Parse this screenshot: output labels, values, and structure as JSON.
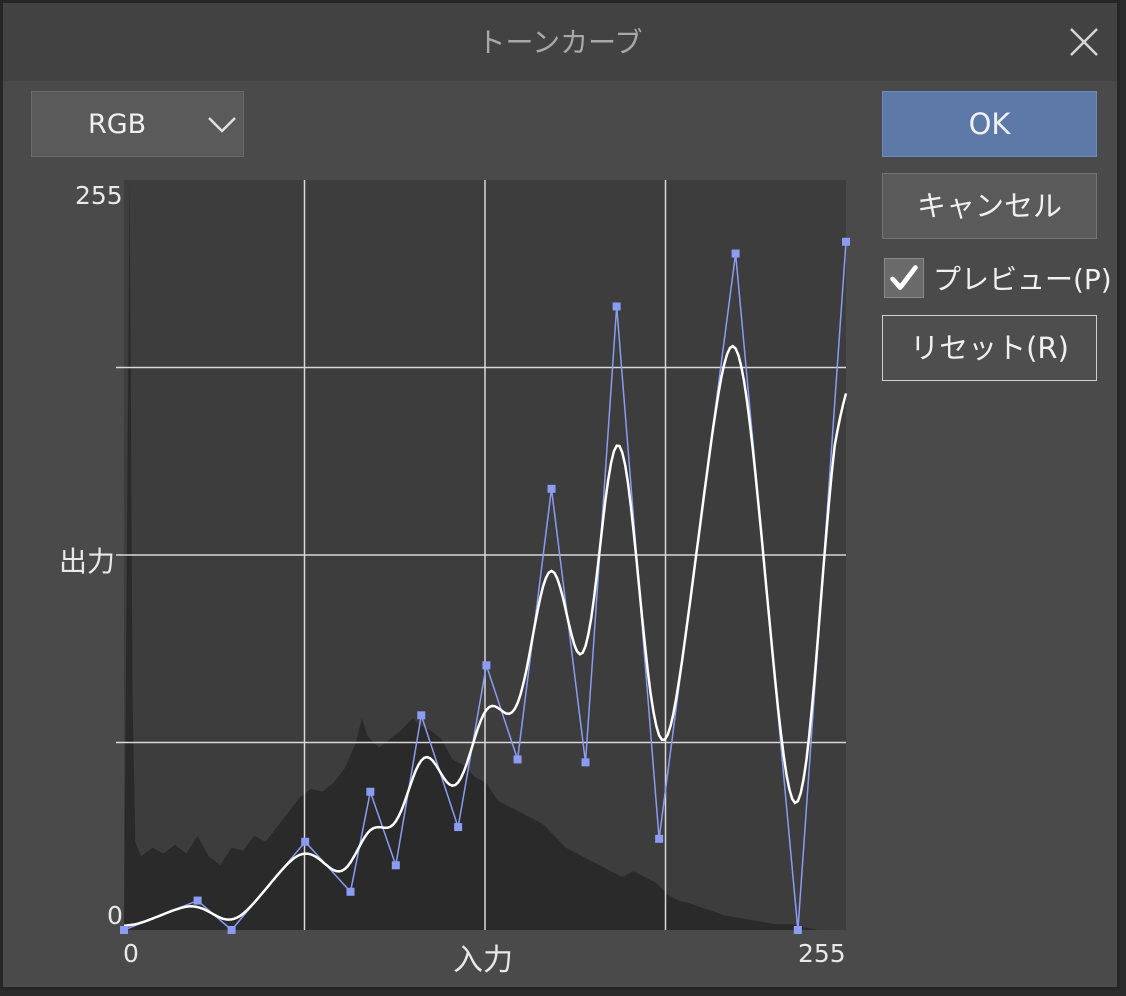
{
  "dialog": {
    "title": "トーンカーブ",
    "close_icon": "close-icon"
  },
  "channel_select": {
    "value": "RGB",
    "icon": "chevron-down-icon"
  },
  "buttons": {
    "ok": "OK",
    "cancel": "キャンセル",
    "reset": "リセット(R)"
  },
  "preview": {
    "label": "プレビュー(P)",
    "checked": true
  },
  "graph": {
    "y_max_label": "255",
    "y_min_label": "0",
    "x_min_label": "0",
    "x_max_label": "255",
    "x_axis_label": "入力",
    "y_axis_label": "出力",
    "colors": {
      "plot_background": "#3d3d3d",
      "histogram": "#2a2a2a",
      "grid": "#d8d8d8",
      "control_points": "#8b9cf2",
      "curve": "#ffffff"
    },
    "range": {
      "min": 0,
      "max": 255
    },
    "control_points": [
      [
        0,
        0
      ],
      [
        26,
        10
      ],
      [
        38,
        0
      ],
      [
        64,
        30
      ],
      [
        80,
        13
      ],
      [
        87,
        47
      ],
      [
        96,
        22
      ],
      [
        105,
        73
      ],
      [
        118,
        35
      ],
      [
        128,
        90
      ],
      [
        139,
        58
      ],
      [
        151,
        150
      ],
      [
        163,
        57
      ],
      [
        174,
        212
      ],
      [
        189,
        31
      ],
      [
        216,
        230
      ],
      [
        238,
        0
      ],
      [
        255,
        234
      ]
    ],
    "histogram": [
      [
        0,
        0
      ],
      [
        2,
        255
      ],
      [
        3,
        80
      ],
      [
        4,
        30
      ],
      [
        6,
        25
      ],
      [
        10,
        28
      ],
      [
        14,
        26
      ],
      [
        18,
        29
      ],
      [
        22,
        26
      ],
      [
        26,
        32
      ],
      [
        30,
        25
      ],
      [
        34,
        22
      ],
      [
        38,
        28
      ],
      [
        42,
        27
      ],
      [
        46,
        32
      ],
      [
        50,
        30
      ],
      [
        54,
        35
      ],
      [
        58,
        40
      ],
      [
        62,
        45
      ],
      [
        66,
        48
      ],
      [
        70,
        47
      ],
      [
        74,
        50
      ],
      [
        78,
        55
      ],
      [
        82,
        64
      ],
      [
        84,
        72
      ],
      [
        86,
        66
      ],
      [
        90,
        62
      ],
      [
        94,
        65
      ],
      [
        98,
        68
      ],
      [
        100,
        70
      ],
      [
        102,
        72
      ],
      [
        104,
        70
      ],
      [
        108,
        68
      ],
      [
        112,
        65
      ],
      [
        116,
        58
      ],
      [
        120,
        56
      ],
      [
        124,
        52
      ],
      [
        128,
        50
      ],
      [
        132,
        44
      ],
      [
        136,
        42
      ],
      [
        140,
        40
      ],
      [
        144,
        38
      ],
      [
        148,
        36
      ],
      [
        152,
        32
      ],
      [
        156,
        28
      ],
      [
        160,
        26
      ],
      [
        164,
        24
      ],
      [
        168,
        22
      ],
      [
        172,
        20
      ],
      [
        176,
        18
      ],
      [
        180,
        20
      ],
      [
        184,
        18
      ],
      [
        188,
        16
      ],
      [
        192,
        12
      ],
      [
        196,
        10
      ],
      [
        200,
        9
      ],
      [
        206,
        7
      ],
      [
        212,
        5
      ],
      [
        218,
        4
      ],
      [
        224,
        3
      ],
      [
        230,
        2
      ],
      [
        236,
        2
      ],
      [
        240,
        1
      ],
      [
        245,
        0
      ]
    ]
  }
}
